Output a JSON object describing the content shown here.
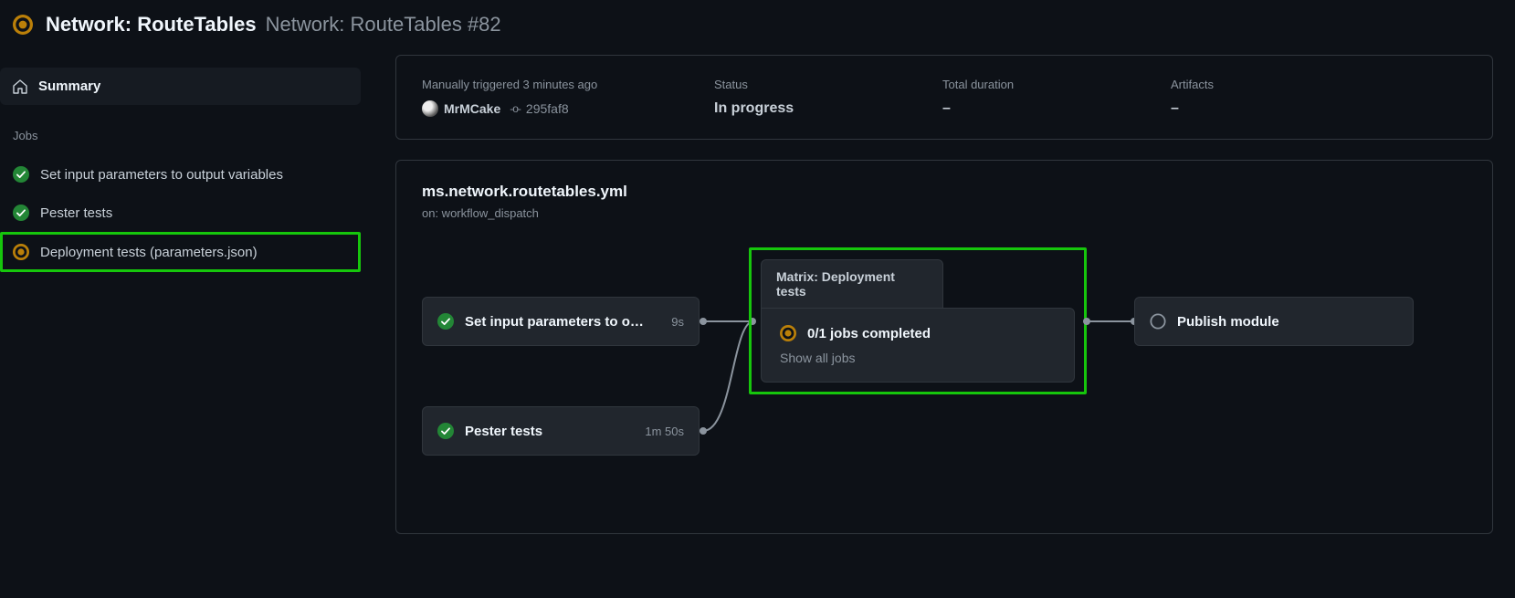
{
  "header": {
    "title": "Network: RouteTables",
    "subtitle": "Network: RouteTables #82"
  },
  "sidebar": {
    "summary_label": "Summary",
    "jobs_heading": "Jobs",
    "jobs": [
      {
        "label": "Set input parameters to output variables",
        "status": "success"
      },
      {
        "label": "Pester tests",
        "status": "success"
      },
      {
        "label": "Deployment tests (parameters.json)",
        "status": "running",
        "highlighted": true
      }
    ]
  },
  "meta": {
    "trigger_text": "Manually triggered 3 minutes ago",
    "actor": "MrMCake",
    "sha": "295faf8",
    "status_label": "Status",
    "status_value": "In progress",
    "duration_label": "Total duration",
    "duration_value": "–",
    "artifacts_label": "Artifacts",
    "artifacts_value": "–"
  },
  "workflow": {
    "file": "ms.network.routetables.yml",
    "trigger": "on: workflow_dispatch"
  },
  "graph": {
    "node1": {
      "label": "Set input parameters to out…",
      "time": "9s"
    },
    "node2": {
      "label": "Pester tests",
      "time": "1m 50s"
    },
    "matrix": {
      "tab": "Matrix: Deployment tests",
      "status_text": "0/1 jobs completed",
      "show_all": "Show all jobs"
    },
    "node4": {
      "label": "Publish module"
    }
  }
}
